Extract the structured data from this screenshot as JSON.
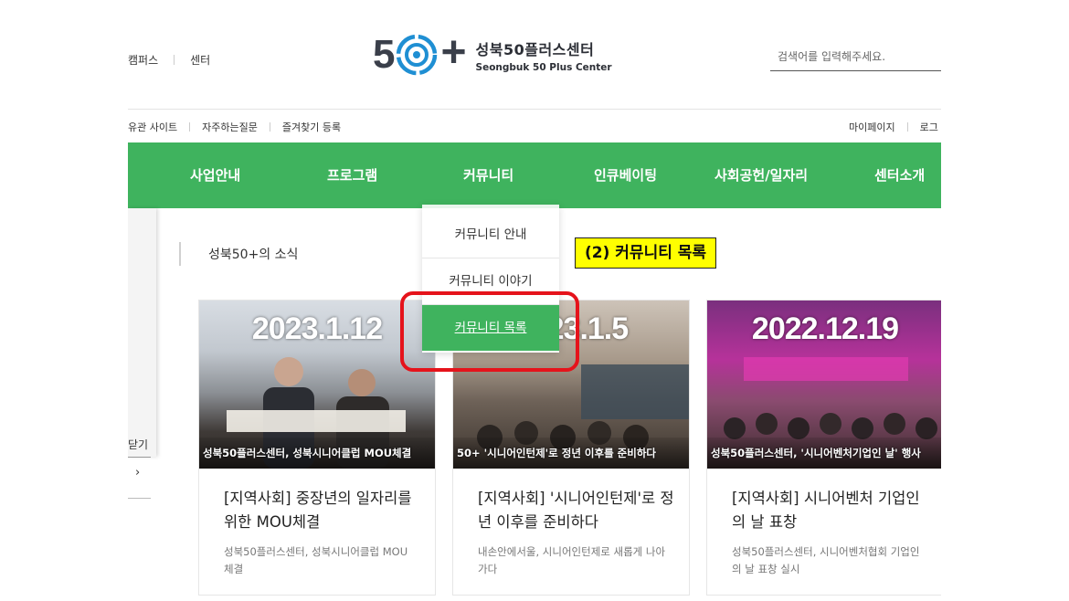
{
  "header": {
    "top_links": [
      "캠퍼스",
      "센터"
    ],
    "logo": {
      "ko": "성북50플러스센터",
      "en": "Seongbuk 50 Plus Center"
    },
    "search_placeholder": "검색어를 입력해주세요."
  },
  "utility": {
    "left": [
      "유관 사이트",
      "자주하는질문",
      "즐겨찾기 등록"
    ],
    "right": [
      "마이페이지",
      "로그"
    ]
  },
  "nav": {
    "items": [
      "사업안내",
      "프로그램",
      "커뮤니티",
      "인큐베이팅",
      "사회공헌/일자리",
      "센터소개"
    ]
  },
  "dropdown": {
    "items": [
      "커뮤니티 안내",
      "커뮤니티 이야기",
      "커뮤니티 목록"
    ],
    "active_index": 2
  },
  "annotation": "(2) 커뮤니티 목록",
  "side": {
    "close_label": "닫기",
    "chevron": "›"
  },
  "news": {
    "section_title": "성북50+의 소식",
    "cards": [
      {
        "date": "2023.1.12",
        "caption": "성북50플러스센터, 성북시니어클럽 MOU체결",
        "title": "[지역사회] 중장년의 일자리를 위한 MOU체결",
        "desc": "성북50플러스센터, 성북시니어클럽 MOU체결"
      },
      {
        "date": "2023.1.5",
        "caption": "50+ '시니어인턴제'로 정년 이후를 준비하다",
        "title": "[지역사회] '시니어인턴제'로 정년 이후를 준비하다",
        "desc": "내손안에서울, 시니어인턴제로 새롭게 나아가다"
      },
      {
        "date": "2022.12.19",
        "caption": "성북50플러스센터, '시니어벤처기업인 날' 행사",
        "title": "[지역사회] 시니어벤처 기업인의 날 표창",
        "desc": "성북50플러스센터, 시니어벤처협회 기업인의 날 표창 실시"
      }
    ]
  },
  "colors": {
    "nav_green": "#3fb35e",
    "highlight_red": "#e5131b",
    "annotation_yellow": "#ffff00"
  }
}
